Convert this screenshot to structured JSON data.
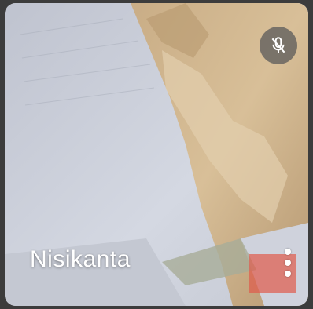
{
  "participant": {
    "name": "Nisikanta",
    "mic_icon": "mic-off-icon",
    "menu_icon": "more-vert-icon"
  },
  "colors": {
    "badge_bg": "#5a5a5a",
    "text": "#ffffff",
    "frame": "#3c3c3c"
  }
}
